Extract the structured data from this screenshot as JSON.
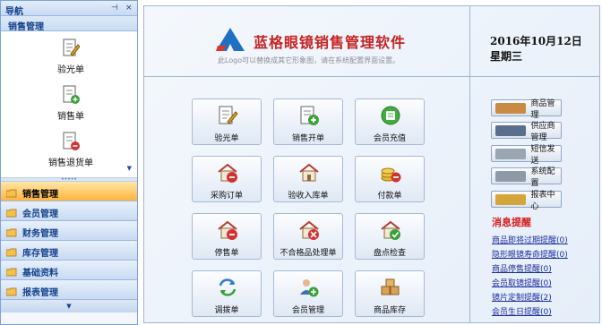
{
  "nav": {
    "title": "导航",
    "pin": "⊣",
    "close": "×",
    "section": "销售管理",
    "items": [
      {
        "label": "验光单",
        "icon": "eye-exam-doc-icon"
      },
      {
        "label": "销售单",
        "icon": "sales-doc-icon"
      },
      {
        "label": "销售退货单",
        "icon": "sales-return-doc-icon"
      }
    ],
    "scroll_down": "▼",
    "grip": "•••••",
    "modules": [
      {
        "label": "销售管理",
        "active": true
      },
      {
        "label": "会员管理",
        "active": false
      },
      {
        "label": "财务管理",
        "active": false
      },
      {
        "label": "库存管理",
        "active": false
      },
      {
        "label": "基础资料",
        "active": false
      },
      {
        "label": "报表管理",
        "active": false
      }
    ],
    "bottom_arrow": "▼"
  },
  "logo": {
    "title": "蓝格眼镜销售管理软件",
    "note": "此Logo可以替换成其它形象图，请在系统配置界面设置。"
  },
  "date": {
    "date": "2016年10月12日",
    "weekday": "星期三"
  },
  "tiles": [
    {
      "label": "验光单",
      "icon": "eye-exam-doc-icon"
    },
    {
      "label": "销售开单",
      "icon": "sales-order-icon"
    },
    {
      "label": "会员充值",
      "icon": "member-recharge-icon"
    },
    {
      "label": "采购订单",
      "icon": "purchase-order-icon"
    },
    {
      "label": "验收入库单",
      "icon": "receiving-icon"
    },
    {
      "label": "付款单",
      "icon": "payment-icon"
    },
    {
      "label": "停售单",
      "icon": "stop-sale-icon"
    },
    {
      "label": "不合格品处理单",
      "icon": "defective-icon"
    },
    {
      "label": "盘点检查",
      "icon": "inventory-check-icon"
    },
    {
      "label": "调拨单",
      "icon": "transfer-icon"
    },
    {
      "label": "会员管理",
      "icon": "member-manage-icon"
    },
    {
      "label": "商品库存",
      "icon": "product-stock-icon"
    }
  ],
  "right_buttons": [
    {
      "label": "商品管理",
      "icon": "product-icon",
      "color": "#c98a44"
    },
    {
      "label": "供应商管理",
      "icon": "supplier-icon",
      "color": "#5a6f8c"
    },
    {
      "label": "短信发送",
      "icon": "sms-icon",
      "color": "#9aa6b4"
    },
    {
      "label": "系统配置",
      "icon": "settings-icon",
      "color": "#8f9aa8"
    },
    {
      "label": "报表中心",
      "icon": "report-icon",
      "color": "#d4a63a"
    }
  ],
  "alerts": {
    "title": "消息提醒",
    "items": [
      "商品即将过期提醒(0)",
      "隐形眼镜寿命提醒(0)",
      "商品停售提醒(0)",
      "会员取镜提醒(0)",
      "镜片定制提醒(2)",
      "会员生日提醒(0)"
    ]
  },
  "colors": {
    "accent": "#ffb43e",
    "brand_red": "#c62222",
    "link": "#1a2d9e"
  }
}
